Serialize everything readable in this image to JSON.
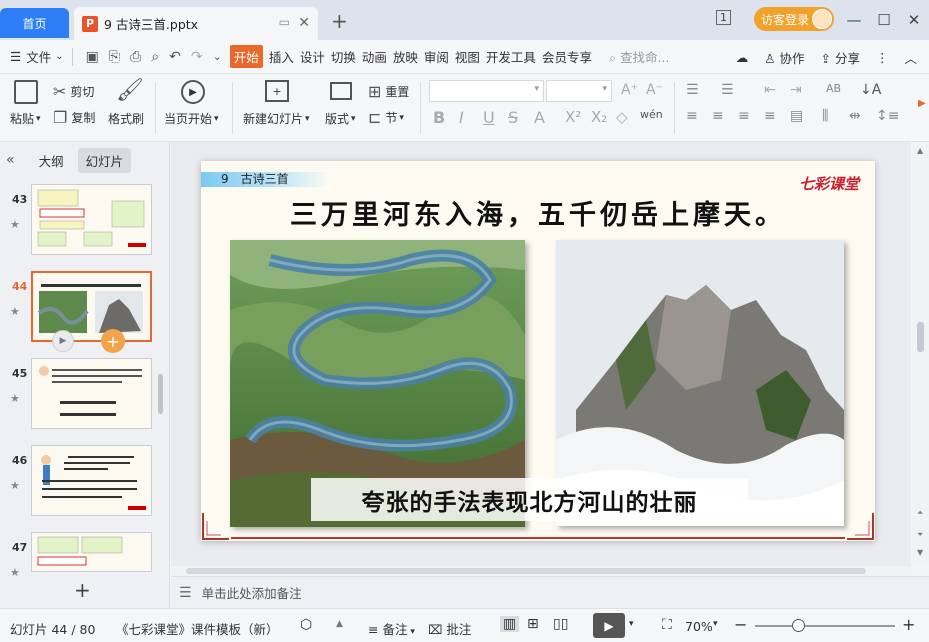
{
  "tabs": {
    "home": "首页",
    "doc_title": "9 古诗三首.pptx"
  },
  "titlebar": {
    "login": "访客登录"
  },
  "menubar": {
    "file": "文件",
    "tabs": [
      "开始",
      "插入",
      "设计",
      "切换",
      "动画",
      "放映",
      "审阅",
      "视图",
      "开发工具",
      "会员专享"
    ],
    "search": "查找命...",
    "collab": "协作",
    "share": "分享"
  },
  "ribbon": {
    "paste": "粘贴",
    "cut": "剪切",
    "copy": "复制",
    "format_painter": "格式刷",
    "from_current": "当页开始",
    "new_slide": "新建幻灯片",
    "layout": "版式",
    "reset": "重置",
    "section": "节"
  },
  "sidebar": {
    "tab_outline": "大纲",
    "tab_slides": "幻灯片",
    "thumbs": [
      {
        "num": "43",
        "selected": false
      },
      {
        "num": "44",
        "selected": true
      },
      {
        "num": "45",
        "selected": false
      },
      {
        "num": "46",
        "selected": false
      },
      {
        "num": "47",
        "selected": false
      }
    ]
  },
  "slide": {
    "label": "9　古诗三首",
    "logo": "七彩课堂",
    "title": "三万里河东入海，五千仞岳上摩天。",
    "caption": "夸张的手法表现北方河山的壮丽"
  },
  "notes": {
    "placeholder": "单击此处添加备注"
  },
  "status": {
    "slide_count": "幻灯片 44 / 80",
    "template": "《七彩课堂》课件模板（新）",
    "notes": "备注",
    "comment": "批注",
    "zoom": "70%"
  }
}
